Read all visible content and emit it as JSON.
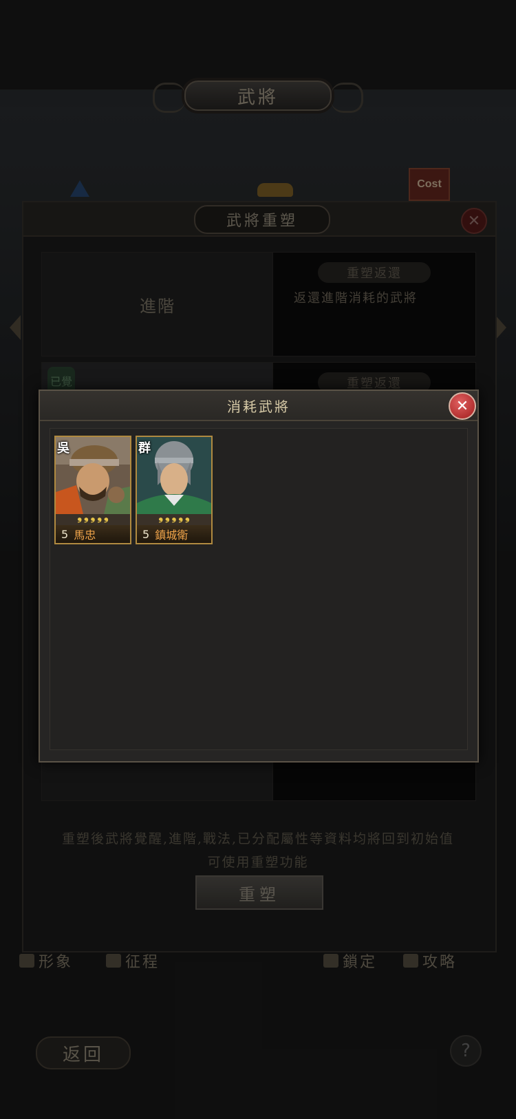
{
  "screen": {
    "title": "武將"
  },
  "rebuild_panel": {
    "title": "武將重塑",
    "close_icon": "close-icon",
    "row1": {
      "left_label": "進階",
      "right_pill": "重塑返還",
      "right_desc": "返還進階消耗的武將"
    },
    "row2": {
      "left_badge": "已覺",
      "right_pill": "重塑返還"
    },
    "notice_line1": "重塑後武將覺醒,進階,戰法,已分配屬性等資料均將回到初始值",
    "notice_line2": "可使用重塑功能",
    "rebuild_button": "重塑"
  },
  "cost_badge": "Cost",
  "tabs": [
    {
      "label": "形象",
      "icon": "figure-icon"
    },
    {
      "label": "征程",
      "icon": "flag-icon"
    },
    {
      "label": "鎖定",
      "icon": "lock-icon"
    },
    {
      "label": "攻略",
      "icon": "book-icon"
    }
  ],
  "back_button": "返回",
  "help_button": "?",
  "modal": {
    "title": "消耗武將",
    "close_icon": "close-icon",
    "cards": [
      {
        "faction": "吳",
        "level": "5",
        "name": "馬忠",
        "stars": 5,
        "name_color": "#f0a44a"
      },
      {
        "faction": "群",
        "level": "5",
        "name": "鎮城衛",
        "stars": 5,
        "name_color": "#f0a44a"
      }
    ]
  }
}
